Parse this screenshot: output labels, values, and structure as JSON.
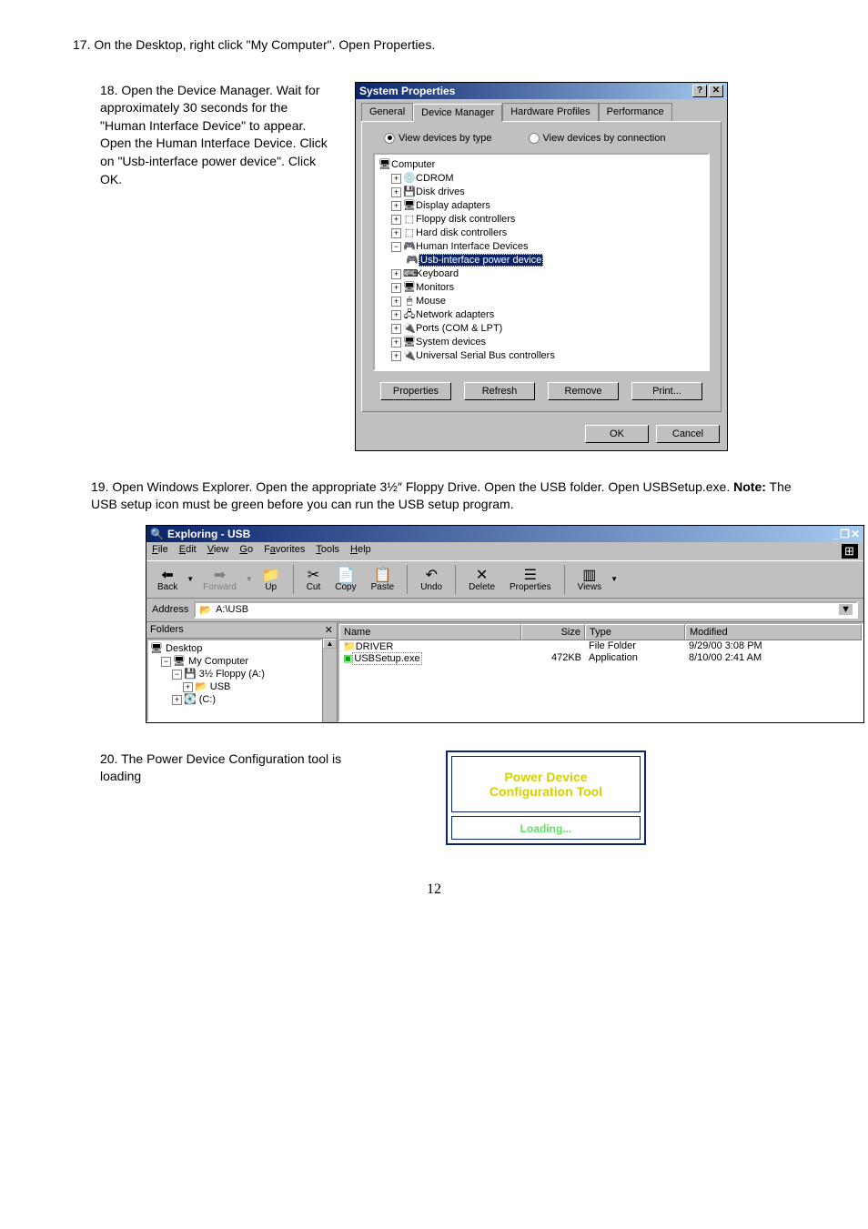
{
  "step17": "17.  On the Desktop, right click \"My Computer\".  Open Properties.",
  "step18": "18.  Open the Device Manager.  Wait for approximately 30 seconds for the \"Human Interface Device\" to appear.  Open the Human Interface Device.  Click on \"Usb-interface power device\".  Click OK.",
  "step19": "19.      Open Windows Explorer.  Open the appropriate 3½″ Floppy Drive.  Open the USB folder.  Open USBSetup.exe.   ",
  "step19_note_label": "Note:",
  "step19_note": "  The USB setup icon must be green before you can run the USB setup program.",
  "step20": "20. The Power Device Configuration tool is loading",
  "page_number": "12",
  "sysprops": {
    "title": "System Properties",
    "tabs": {
      "general": "General",
      "devmgr": "Device Manager",
      "hwprof": "Hardware Profiles",
      "perf": "Performance"
    },
    "radio_type": "View devices by type",
    "radio_conn": "View devices by connection",
    "tree": {
      "root": "Computer",
      "items": [
        "CDROM",
        "Disk drives",
        "Display adapters",
        "Floppy disk controllers",
        "Hard disk controllers",
        "Human Interface Devices",
        "Keyboard",
        "Monitors",
        "Mouse",
        "Network adapters",
        "Ports (COM & LPT)",
        "System devices",
        "Universal Serial Bus controllers"
      ],
      "hid_child": "Usb-interface power device"
    },
    "buttons": {
      "properties": "Properties",
      "refresh": "Refresh",
      "remove": "Remove",
      "print": "Print..."
    },
    "footer": {
      "ok": "OK",
      "cancel": "Cancel"
    }
  },
  "explorer": {
    "title": "Exploring - USB",
    "menu": {
      "file": "File",
      "edit": "Edit",
      "view": "View",
      "go": "Go",
      "favorites": "Favorites",
      "tools": "Tools",
      "help": "Help"
    },
    "toolbar": {
      "back": "Back",
      "forward": "Forward",
      "up": "Up",
      "cut": "Cut",
      "copy": "Copy",
      "paste": "Paste",
      "undo": "Undo",
      "delete": "Delete",
      "properties": "Properties",
      "views": "Views"
    },
    "address_label": "Address",
    "address": "A:\\USB",
    "folders_label": "Folders",
    "tree": {
      "desktop": "Desktop",
      "my_computer": "My Computer",
      "floppy": "3½ Floppy (A:)",
      "usb": "USB",
      "c": "(C:)"
    },
    "cols": {
      "name": "Name",
      "size": "Size",
      "type": "Type",
      "modified": "Modified"
    },
    "rows": [
      {
        "name": "DRIVER",
        "size": "",
        "type": "File Folder",
        "modified": "9/29/00 3:08 PM"
      },
      {
        "name": "USBSetup.exe",
        "size": "472KB",
        "type": "Application",
        "modified": "8/10/00 2:41 AM"
      }
    ]
  },
  "loading": {
    "line1": "Power Device",
    "line2": "Configuration Tool",
    "status": "Loading..."
  }
}
